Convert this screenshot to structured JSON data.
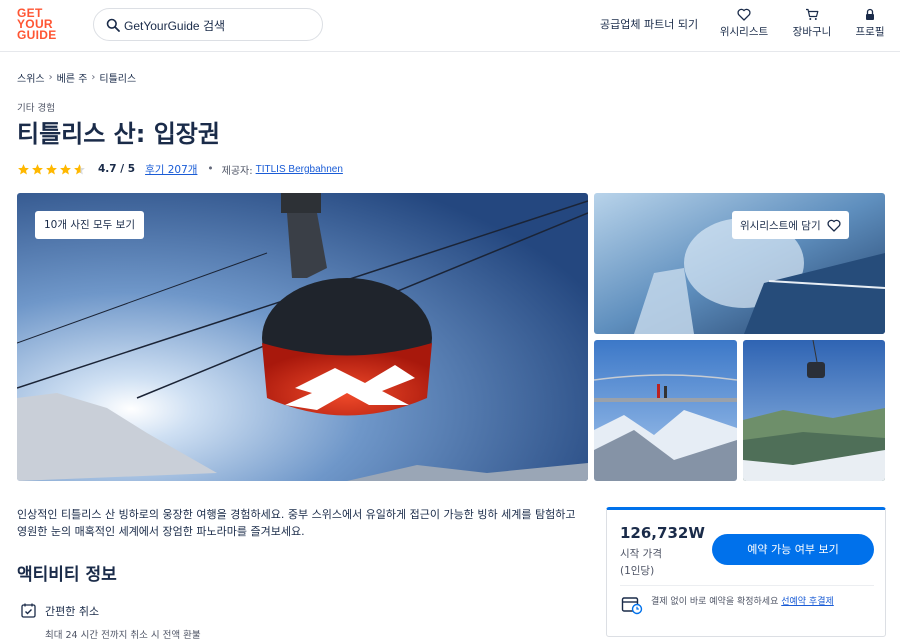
{
  "header": {
    "logo_lines": [
      "GET",
      "YOUR",
      "GUIDE"
    ],
    "search_placeholder": "GetYourGuide 검색",
    "partner_link": "공급업체 파트너 되기",
    "wishlist_label": "위시리스트",
    "cart_label": "장바구니",
    "profile_label": "프로필"
  },
  "breadcrumb": [
    "스위스",
    "베른 주",
    "티틀리스"
  ],
  "activity": {
    "category": "기타 경험",
    "title": "티틀리스 산: 입장권",
    "rating_value": 4.7,
    "rating_text": "4.7 / 5",
    "reviews_text": "후기 207개",
    "provider_label": "제공자:",
    "provider_name": "TITLIS Bergbahnen"
  },
  "gallery": {
    "view_all_label": "10개 사진 모두 보기",
    "wishlist_add_label": "위시리스트에 담기"
  },
  "description": "인상적인 티틀리스 산 빙하로의 웅장한 여행을 경험하세요. 중부 스위스에서 유일하게 접근이 가능한 빙하 세계를 탐험하고 영원한 눈의 매혹적인 세계에서 장엄한 파노라마를 즐겨보세요.",
  "info_section": {
    "title": "액티비티 정보",
    "feature_title": "간편한 취소",
    "feature_subtitle": "최대 24 시간 전까지 취소 시 전액 환불"
  },
  "booking": {
    "price": "126,732W",
    "price_label": "시작 가격",
    "price_per": "(1인당)",
    "check_button": "예약 가능 여부 보기",
    "info_text": "결제 없이 바로 예약을 확정하세요 ",
    "info_link": "선예약 후결제"
  },
  "colors": {
    "brand": "#ff5533",
    "primary_button": "#0071eb",
    "link": "#1a5cd6",
    "star": "#ffb800",
    "text": "#1a2b49"
  }
}
